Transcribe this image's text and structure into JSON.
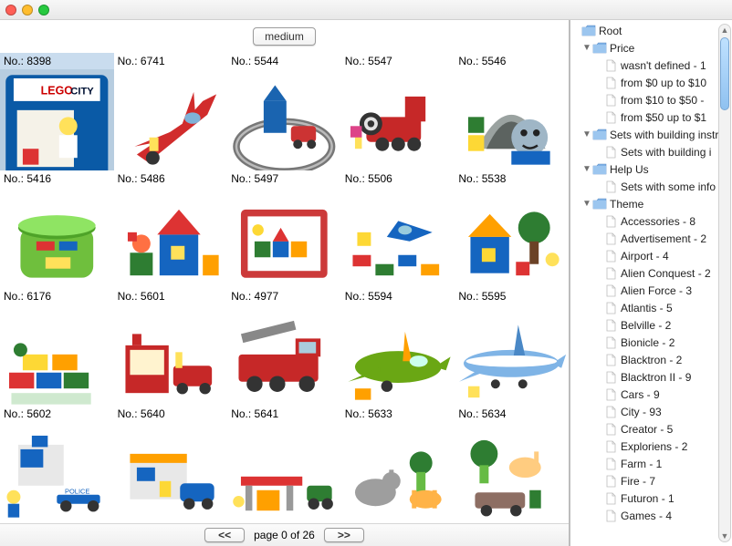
{
  "titlebar": {
    "close": "close",
    "min": "minimize",
    "zoom": "zoom"
  },
  "toolbar": {
    "size_button": "medium"
  },
  "grid": {
    "items": [
      {
        "label": "No.: 8398",
        "selected": true
      },
      {
        "label": "No.: 6741"
      },
      {
        "label": "No.: 5544"
      },
      {
        "label": "No.: 5547"
      },
      {
        "label": "No.: 5546"
      },
      {
        "label": "No.: 5416"
      },
      {
        "label": "No.: 5486"
      },
      {
        "label": "No.: 5497"
      },
      {
        "label": "No.: 5506"
      },
      {
        "label": "No.: 5538"
      },
      {
        "label": "No.: 6176"
      },
      {
        "label": "No.: 5601"
      },
      {
        "label": "No.: 4977"
      },
      {
        "label": "No.: 5594"
      },
      {
        "label": "No.: 5595"
      },
      {
        "label": "No.: 5602"
      },
      {
        "label": "No.: 5640"
      },
      {
        "label": "No.: 5641"
      },
      {
        "label": "No.: 5633"
      },
      {
        "label": "No.: 5634"
      }
    ]
  },
  "pager": {
    "prev_label": "<<",
    "next_label": ">>",
    "status": "page 0 of 26"
  },
  "tree": {
    "root_label": "Root",
    "nodes": [
      {
        "type": "folder",
        "label": "Price",
        "expanded": true,
        "children": [
          {
            "type": "file",
            "label": "wasn't defined - 1"
          },
          {
            "type": "file",
            "label": "from $0 up to $10"
          },
          {
            "type": "file",
            "label": "from $10 to $50 -"
          },
          {
            "type": "file",
            "label": "from $50 up to $1"
          }
        ]
      },
      {
        "type": "folder",
        "label": "Sets with building instr",
        "expanded": true,
        "children": [
          {
            "type": "file",
            "label": "Sets with building i"
          }
        ]
      },
      {
        "type": "folder",
        "label": "Help Us",
        "expanded": true,
        "children": [
          {
            "type": "file",
            "label": "Sets with some info"
          }
        ]
      },
      {
        "type": "folder",
        "label": "Theme",
        "expanded": true,
        "children": [
          {
            "type": "file",
            "label": "Accessories - 8"
          },
          {
            "type": "file",
            "label": "Advertisement - 2"
          },
          {
            "type": "file",
            "label": "Airport - 4"
          },
          {
            "type": "file",
            "label": "Alien Conquest - 2"
          },
          {
            "type": "file",
            "label": "Alien Force - 3"
          },
          {
            "type": "file",
            "label": "Atlantis - 5"
          },
          {
            "type": "file",
            "label": "Belville - 2"
          },
          {
            "type": "file",
            "label": "Bionicle - 2"
          },
          {
            "type": "file",
            "label": "Blacktron - 2"
          },
          {
            "type": "file",
            "label": "Blacktron II - 9"
          },
          {
            "type": "file",
            "label": "Cars - 9"
          },
          {
            "type": "file",
            "label": "City - 93"
          },
          {
            "type": "file",
            "label": "Creator - 5"
          },
          {
            "type": "file",
            "label": "Exploriens - 2"
          },
          {
            "type": "file",
            "label": "Farm - 1"
          },
          {
            "type": "file",
            "label": "Fire - 7"
          },
          {
            "type": "file",
            "label": "Futuron - 1"
          },
          {
            "type": "file",
            "label": "Games - 4"
          }
        ]
      }
    ]
  }
}
